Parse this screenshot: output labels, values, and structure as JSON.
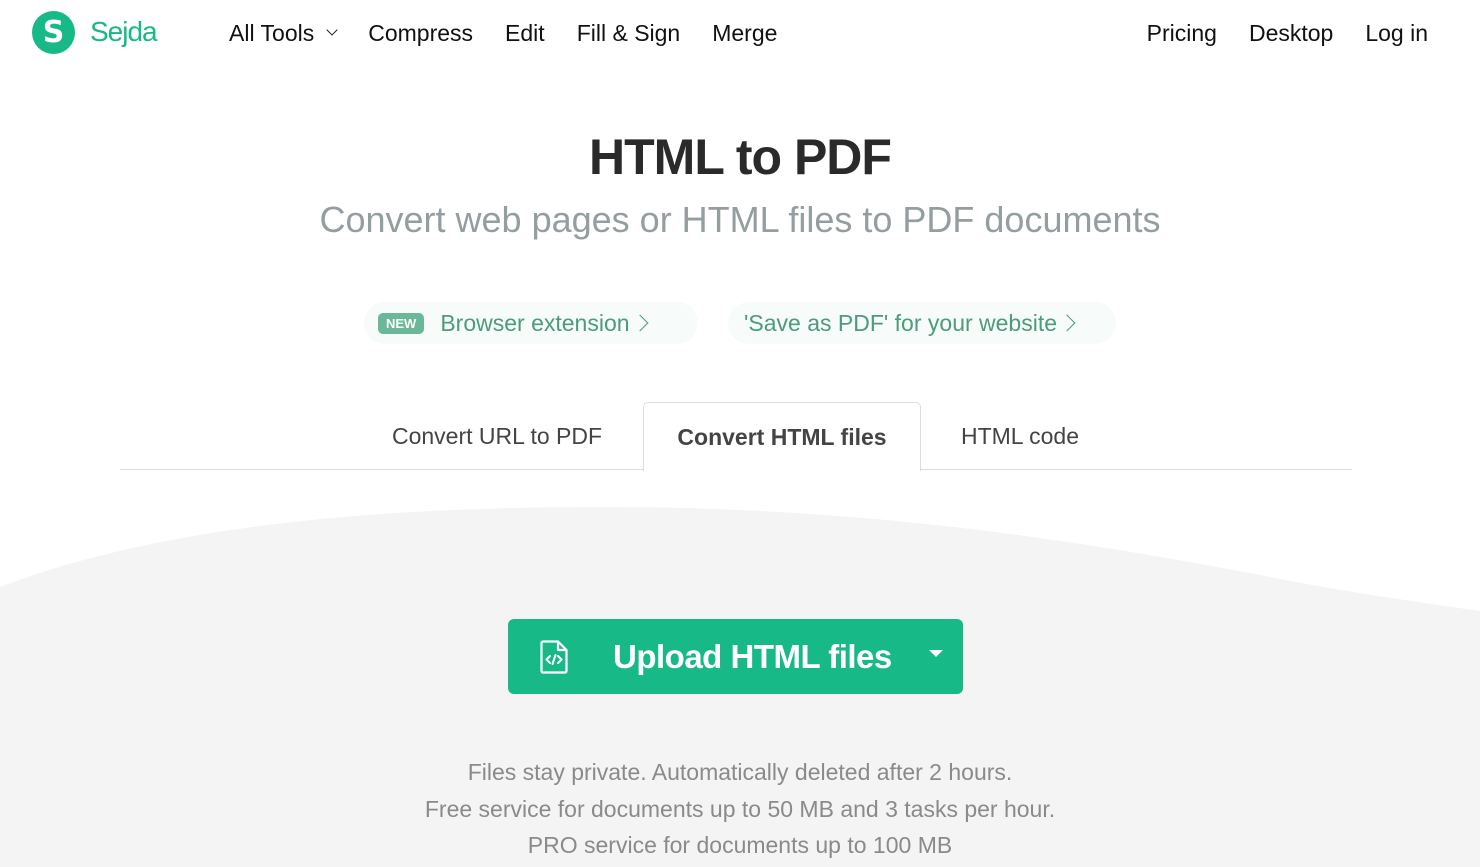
{
  "brand": {
    "logo_letter": "S",
    "name": "Sejda",
    "color": "#17b987"
  },
  "nav": {
    "left": [
      {
        "label": "All Tools",
        "has_dropdown": true
      },
      {
        "label": "Compress"
      },
      {
        "label": "Edit"
      },
      {
        "label": "Fill & Sign"
      },
      {
        "label": "Merge"
      }
    ],
    "right": [
      {
        "label": "Pricing"
      },
      {
        "label": "Desktop"
      },
      {
        "label": "Log in"
      }
    ]
  },
  "hero": {
    "title": "HTML to PDF",
    "subtitle": "Convert web pages or HTML files to PDF documents"
  },
  "pills": [
    {
      "badge": "NEW",
      "label": "Browser extension"
    },
    {
      "label": "'Save as PDF' for your website"
    }
  ],
  "tabs": [
    {
      "label": "Convert URL to PDF",
      "active": false
    },
    {
      "label": "Convert HTML files",
      "active": true
    },
    {
      "label": "HTML code",
      "active": false
    }
  ],
  "upload": {
    "label": "Upload HTML files",
    "icon": "html-file-icon",
    "dropdown_icon": "caret-down-icon"
  },
  "info": [
    "Files stay private. Automatically deleted after 2 hours.",
    "Free service for documents up to 50 MB and 3 tasks per hour.",
    "PRO service for documents up to 100 MB"
  ]
}
